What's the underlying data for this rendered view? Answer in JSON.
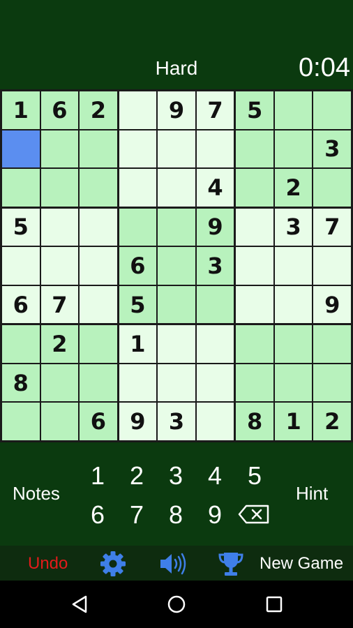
{
  "header": {
    "difficulty": "Hard",
    "timer": "0:04"
  },
  "board": {
    "rows": [
      [
        "1",
        "6",
        "2",
        "",
        "9",
        "7",
        "5",
        "",
        ""
      ],
      [
        "",
        "",
        "",
        "",
        "",
        "",
        "",
        "",
        "3"
      ],
      [
        "",
        "",
        "",
        "",
        "",
        "4",
        "",
        "2",
        ""
      ],
      [
        "5",
        "",
        "",
        "",
        "",
        "9",
        "",
        "3",
        "7"
      ],
      [
        "",
        "",
        "",
        "6",
        "",
        "3",
        "",
        "",
        ""
      ],
      [
        "6",
        "7",
        "",
        "5",
        "",
        "",
        "",
        "",
        "9"
      ],
      [
        "",
        "2",
        "",
        "1",
        "",
        "",
        "",
        "",
        ""
      ],
      [
        "8",
        "",
        "",
        "",
        "",
        "",
        "",
        "",
        ""
      ],
      [
        "",
        "",
        "6",
        "9",
        "3",
        "",
        "8",
        "1",
        "2"
      ]
    ],
    "selected": [
      1,
      0
    ],
    "colors": {
      "shaded": "#b8f2bd",
      "light": "#e8fde8",
      "selected": "#5b8ef0",
      "border": "#1a1a1a"
    }
  },
  "keypad": {
    "notes_label": "Notes",
    "hint_label": "Hint",
    "numbers": [
      "1",
      "2",
      "3",
      "4",
      "5",
      "6",
      "7",
      "8",
      "9"
    ],
    "erase_icon": "backspace-icon"
  },
  "toolbar": {
    "undo_label": "Undo",
    "settings_icon": "gear-icon",
    "sound_icon": "speaker-icon",
    "trophy_icon": "trophy-icon",
    "new_game_label": "New Game",
    "accent": "#3f7fe8",
    "undo_color": "#e21b1b"
  },
  "navbar": {
    "back_icon": "back-triangle-icon",
    "home_icon": "home-circle-icon",
    "recents_icon": "recents-square-icon"
  }
}
